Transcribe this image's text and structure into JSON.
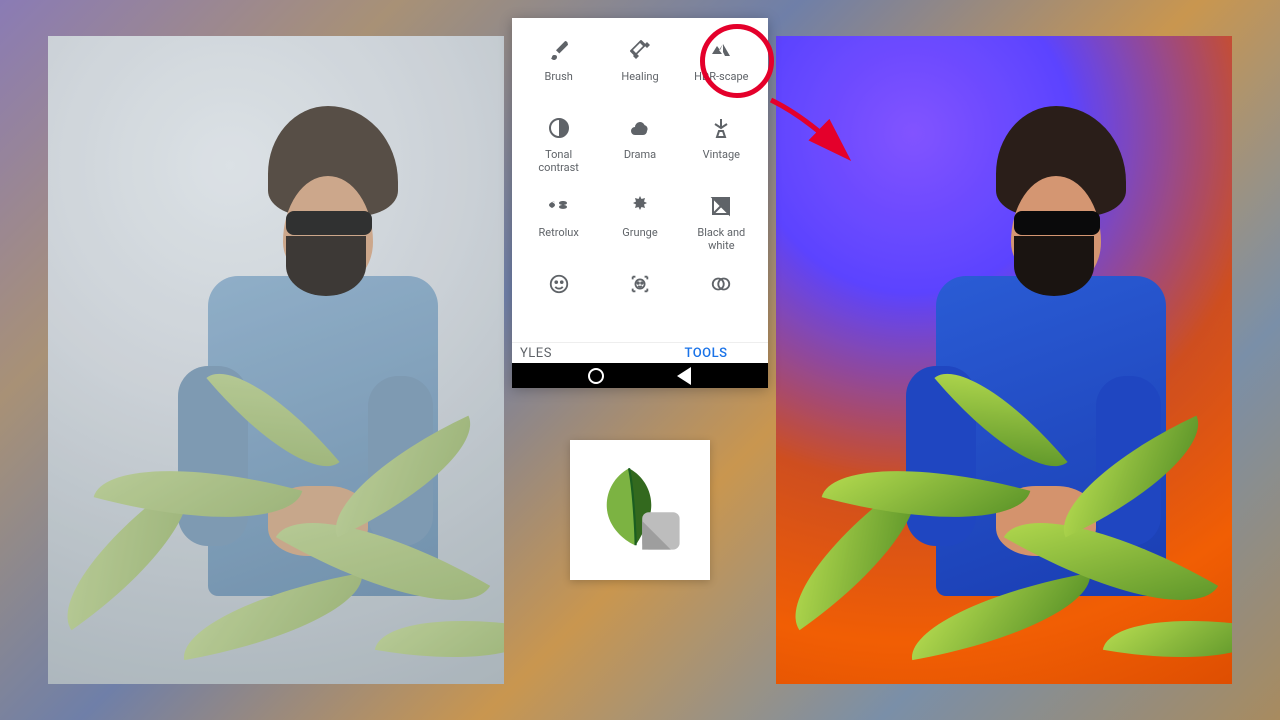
{
  "tools": [
    {
      "name": "brush",
      "label": "Brush"
    },
    {
      "name": "healing",
      "label": "Healing"
    },
    {
      "name": "hdr-scape",
      "label": "HDR-scape"
    },
    {
      "name": "tonal-contrast",
      "label": "Tonal contrast"
    },
    {
      "name": "drama",
      "label": "Drama"
    },
    {
      "name": "vintage",
      "label": "Vintage"
    },
    {
      "name": "retrolux",
      "label": "Retrolux"
    },
    {
      "name": "grunge",
      "label": "Grunge"
    },
    {
      "name": "black-and-white",
      "label": "Black and white"
    },
    {
      "name": "face-enhance",
      "label": ""
    },
    {
      "name": "face-pose",
      "label": ""
    },
    {
      "name": "double-exposure",
      "label": ""
    }
  ],
  "tabs": {
    "styles": "YLES",
    "tools": "TOOLS"
  },
  "highlight": {
    "target": "hdr-scape"
  },
  "colors": {
    "accent": "#1a73e8",
    "highlight": "#e4002b"
  }
}
